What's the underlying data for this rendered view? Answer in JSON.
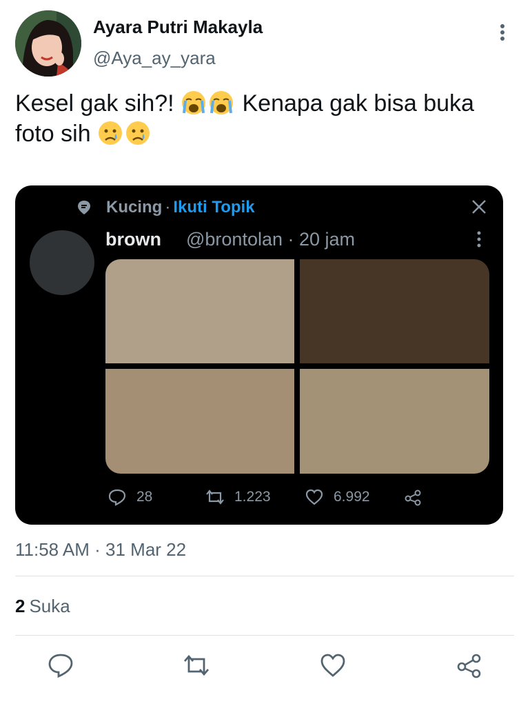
{
  "author": {
    "display_name": "Ayara Putri Makayla",
    "handle": "@Aya_ay_yara"
  },
  "tweet": {
    "text_line1_a": "Kesel gak sih?! ",
    "text_line1_b": " Kenapa gak bisa buka",
    "text_line2": "foto sih ",
    "emojis_line1": [
      "loudly-crying-face",
      "loudly-crying-face"
    ],
    "emojis_line2": [
      "crying-face",
      "crying-face"
    ]
  },
  "embed": {
    "topic_name": "Kucing",
    "topic_separator": "·",
    "follow_label": "Ikuti Topik",
    "author_name": "brown",
    "author_meta": "@brontolan · 20 jam",
    "photo_colors": [
      "#b09f89",
      "#473526",
      "#a48f74",
      "#a49277"
    ],
    "actions": {
      "replies": "28",
      "retweets": "1.223",
      "likes": "6.992"
    }
  },
  "timestamp": "11:58 AM · 31 Mar 22",
  "likes": {
    "count": "2",
    "label": "Suka"
  },
  "colors": {
    "accent": "#1d9bf0",
    "text_primary": "#0f1419",
    "text_secondary": "#536471",
    "embed_bg": "#000000"
  },
  "icons": [
    "more-vertical-icon",
    "topic-icon",
    "close-icon",
    "reply-icon",
    "retweet-icon",
    "like-icon",
    "share-icon"
  ]
}
